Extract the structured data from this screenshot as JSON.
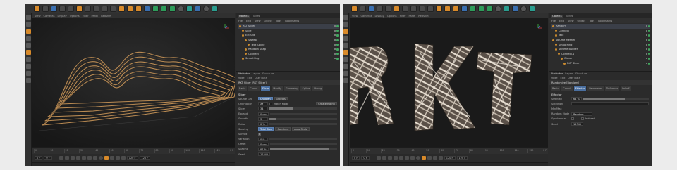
{
  "left": {
    "viewport_menu": [
      "View",
      "Cameras",
      "Display",
      "Options",
      "Filter",
      "Panel",
      "Redshift"
    ],
    "object_manager": {
      "tabs": [
        "Objects",
        "Takes"
      ],
      "menu": [
        "File",
        "Edit",
        "View",
        "Object",
        "Tags",
        "Bookmarks"
      ],
      "items": [
        {
          "name": "RKT Slicer",
          "indent": 0,
          "selected": true
        },
        {
          "name": "Slice",
          "indent": 1,
          "selected": false
        },
        {
          "name": "Extrude",
          "indent": 1,
          "selected": false
        },
        {
          "name": "Sweep",
          "indent": 2,
          "selected": false
        },
        {
          "name": "Text Spline",
          "indent": 3,
          "selected": false
        },
        {
          "name": "Random Shap",
          "indent": 2,
          "selected": false
        },
        {
          "name": "Connect",
          "indent": 2,
          "selected": false
        },
        {
          "name": "Smoothing",
          "indent": 1,
          "selected": false
        }
      ]
    },
    "attributes": {
      "tabs": [
        "Attributes",
        "Layers",
        "Structure"
      ],
      "menu": [
        "Mode",
        "Edit",
        "User Data"
      ],
      "object_name": "RKT Slicer [RKT Slicer]",
      "section_tabs": [
        "Basic",
        "Coord.",
        "Slicer",
        "Modify",
        "Geometry",
        "Spline",
        "Phong"
      ],
      "active_tab": "Slicer",
      "section": "Slicer",
      "params": [
        {
          "label": "Source Geo",
          "kind": "buttons",
          "values": [
            "Children",
            "Objects"
          ],
          "active": 0
        },
        {
          "label": "Orientation",
          "kind": "field",
          "value": "XY",
          "extra": "Match Mode",
          "button": "Create Matrix"
        },
        {
          "label": "Slices",
          "kind": "slider",
          "value": "34",
          "fill": 0.35
        },
        {
          "label": "Expand",
          "kind": "slider",
          "value": "0 cm",
          "fill": 0
        },
        {
          "label": "Smooth",
          "kind": "slider",
          "value": "3",
          "fill": 0.1
        },
        {
          "label": "Ratio",
          "kind": "slider",
          "value": "0 %",
          "fill": 0
        },
        {
          "label": "Spacing",
          "kind": "buttons3",
          "values": [
            "Total Size",
            "Constant",
            "Auto Scale"
          ],
          "active": 0
        },
        {
          "label": "Spread",
          "kind": "check",
          "checked": true
        },
        {
          "label": "Variation",
          "kind": "slider",
          "value": "0 %",
          "fill": 0
        },
        {
          "label": "Offset",
          "kind": "slider",
          "value": "0 cm",
          "fill": 0
        },
        {
          "label": "Spacing",
          "kind": "slider",
          "value": "87 %",
          "fill": 0.87
        },
        {
          "label": "Seed",
          "kind": "field",
          "value": "12345"
        }
      ]
    },
    "timeline": {
      "ticks": [
        "0",
        "10",
        "20",
        "30",
        "40",
        "50",
        "60",
        "70",
        "80",
        "90",
        "100",
        "110",
        "120"
      ],
      "end": "0 F"
    },
    "playback": {
      "start": "0 F",
      "current": "0 F",
      "end": "120 F",
      "end2": "120 F"
    }
  },
  "right": {
    "viewport_menu": [
      "View",
      "Cameras",
      "Display",
      "Options",
      "Filter",
      "Panel",
      "Redshift"
    ],
    "object_manager": {
      "tabs": [
        "Objects",
        "Takes"
      ],
      "menu": [
        "File",
        "Edit",
        "View",
        "Object",
        "Tags",
        "Bookmarks"
      ],
      "items": [
        {
          "name": "Random",
          "indent": 0,
          "selected": true
        },
        {
          "name": "Connect",
          "indent": 1,
          "selected": false
        },
        {
          "name": "Text",
          "indent": 1,
          "selected": false
        },
        {
          "name": "Volume Mesher",
          "indent": 0,
          "selected": false
        },
        {
          "name": "Smoothing",
          "indent": 1,
          "selected": false
        },
        {
          "name": "Volume Builder",
          "indent": 1,
          "selected": false
        },
        {
          "name": "Connect.1",
          "indent": 2,
          "selected": false
        },
        {
          "name": "Cloner",
          "indent": 3,
          "selected": false
        },
        {
          "name": "RKT Slicer",
          "indent": 4,
          "selected": false
        }
      ]
    },
    "attributes": {
      "tabs": [
        "Attributes",
        "Layers",
        "Structure"
      ],
      "menu": [
        "Mode",
        "Edit",
        "User Data"
      ],
      "object_name": "Randomize [Random]",
      "section_tabs": [
        "Basic",
        "Coord.",
        "Effector",
        "Parameter",
        "Deformer",
        "Falloff"
      ],
      "active_tab": "Effector",
      "section": "Effector",
      "params": [
        {
          "label": "Strength",
          "kind": "slider",
          "value": "64 %",
          "fill": 0.64
        },
        {
          "label": "Selection",
          "kind": "field",
          "value": ""
        },
        {
          "label": "Min/Max",
          "kind": "section"
        },
        {
          "label": "Random Mode",
          "kind": "field",
          "value": "Random"
        },
        {
          "label": "Synchronize",
          "kind": "check2",
          "checked": false,
          "extra": "Indexed"
        },
        {
          "label": "Seed",
          "kind": "field",
          "value": "12345"
        }
      ]
    },
    "timeline": {
      "ticks": [
        "0",
        "10",
        "20",
        "30",
        "40",
        "50",
        "60",
        "70",
        "80",
        "90",
        "100",
        "110",
        "120"
      ],
      "end": "0 F"
    },
    "playback": {
      "start": "0 F",
      "current": "0 F",
      "end": "120 F",
      "end2": "120 F"
    }
  }
}
